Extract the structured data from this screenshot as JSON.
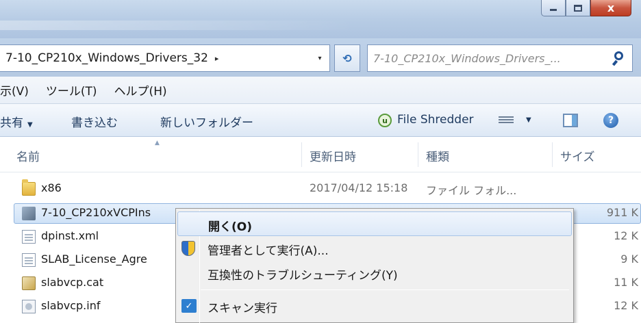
{
  "window": {
    "controls": {
      "minimize_icon": "minimize-icon",
      "maximize_icon": "maximize-icon",
      "close_glyph": "x"
    }
  },
  "address_bar": {
    "path": "7-10_CP210x_Windows_Drivers_32",
    "breadcrumb_arrow": "▸",
    "dropdown_arrow": "▾",
    "refresh_glyph": "⁴↑"
  },
  "search": {
    "placeholder": "7-10_CP210x_Windows_Drivers_..."
  },
  "menubar": {
    "items": [
      "示(V)",
      "ツール(T)",
      "ヘルプ(H)"
    ]
  },
  "toolbar": {
    "share": "共有",
    "burn": "書き込む",
    "new_folder": "新しいフォルダー",
    "shredder_badge": "u",
    "file_shredder": "File Shredder",
    "help_glyph": "?"
  },
  "columns": {
    "name": "名前",
    "date": "更新日時",
    "type": "種類",
    "size": "サイズ"
  },
  "files": [
    {
      "name": "x86",
      "date": "2017/04/12 15:18",
      "type": "ファイル フォル...",
      "size": "",
      "icon": "folder-icon"
    },
    {
      "name": "7-10_CP210xVCPIns",
      "date": "",
      "type": "",
      "size": "911 K",
      "icon": "installer-icon"
    },
    {
      "name": "dpinst.xml",
      "date": "",
      "type": "",
      "size": "12 K",
      "icon": "xml-file-icon"
    },
    {
      "name": "SLAB_License_Agre",
      "date": "",
      "type": "",
      "size": "9 K",
      "icon": "document-icon"
    },
    {
      "name": "slabvcp.cat",
      "date": "",
      "type": "",
      "size": "11 K",
      "icon": "catalog-file-icon"
    },
    {
      "name": "slabvcp.inf",
      "date": "",
      "type": "",
      "size": "12 K",
      "icon": "inf-file-icon"
    }
  ],
  "context_menu": {
    "open": "開く(O)",
    "run_as_admin": "管理者として実行(A)...",
    "troubleshoot": "互換性のトラブルシューティング(Y)",
    "scan": "スキャン実行",
    "scan_glyph": "✓"
  },
  "colors": {
    "selection": "#cfe2f7",
    "menu_bg": "#f0f0f0",
    "title_bar": "#b6cbe4"
  }
}
